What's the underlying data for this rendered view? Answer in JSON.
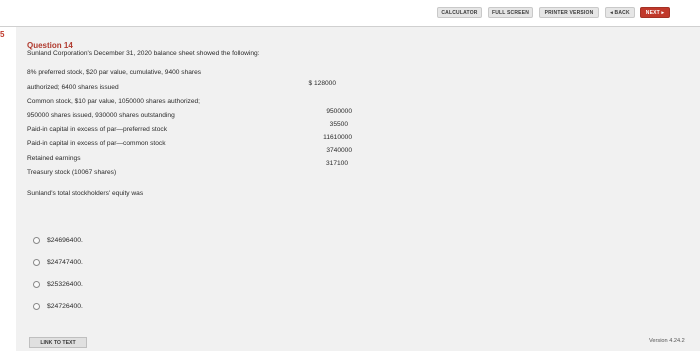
{
  "toolbar": {
    "calculator": "CALCULATOR",
    "fullscreen": "FULL SCREEN",
    "printer": "PRINTER VERSION",
    "back": "◂ BACK",
    "next": "NEXT ▸"
  },
  "side_marker": "5",
  "question": {
    "title": "Question 14",
    "intro": "Sunland Corporation's December 31, 2020 balance sheet showed the following:",
    "lines": [
      "8% preferred stock, $20 par value, cumulative, 9400 shares",
      "authorized; 6400 shares issued",
      "Common stock, $10 par value, 1050000 shares authorized;",
      "950000 shares issued, 930000 shares outstanding",
      "Paid-in capital in excess of par—preferred stock",
      "Paid-in capital in excess of par—common stock",
      "Retained earnings",
      "Treasury stock (10067 shares)"
    ],
    "amounts": [
      "$ 128000",
      "9500000",
      "35500",
      "11610000",
      "3740000",
      "317100"
    ],
    "prompt": "Sunland's total stockholders' equity was"
  },
  "choices": [
    "$24696400.",
    "$24747400.",
    "$25326400.",
    "$24726400."
  ],
  "footer": {
    "link_to_text": "LINK TO TEXT",
    "version": "Version 4.24.2"
  }
}
